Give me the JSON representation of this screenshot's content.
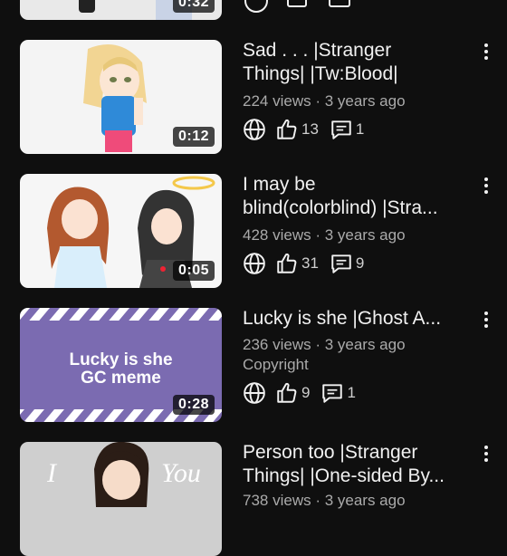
{
  "videos": [
    {
      "duration": "0:32"
    },
    {
      "title_line1": "Sad . . . |Stranger",
      "title_line2": "Things| |Tw:Blood|",
      "meta": "224 views · 3 years ago",
      "likes": "13",
      "comments": "1",
      "duration": "0:12"
    },
    {
      "title_line1": "I may be",
      "title_line2": "blind(colorblind) |Stra...",
      "meta": "428 views · 3 years ago",
      "likes": "31",
      "comments": "9",
      "duration": "0:05"
    },
    {
      "title_line1": "Lucky is she |Ghost A...",
      "meta": "236 views · 3 years ago",
      "badge": "Copyright",
      "likes": "9",
      "comments": "1",
      "duration": "0:28",
      "thumb_text_line1": "Lucky is she",
      "thumb_text_line2": "GC meme"
    },
    {
      "title_line1": "Person too |Stranger",
      "title_line2": "Things| |One-sided By...",
      "meta": "738 views · 3 years ago",
      "thumb_word_left": "I",
      "thumb_word_right": "You"
    }
  ],
  "icons": {
    "visibility": "globe-icon",
    "likes": "thumbs-up-icon",
    "comments": "comment-icon",
    "menu": "more-vertical-icon"
  },
  "colors": {
    "background": "#0f0f0f",
    "primary_text": "#f1f1f1",
    "secondary_text": "#aaaaaa",
    "thumb_purple": "#7b6bb1"
  }
}
